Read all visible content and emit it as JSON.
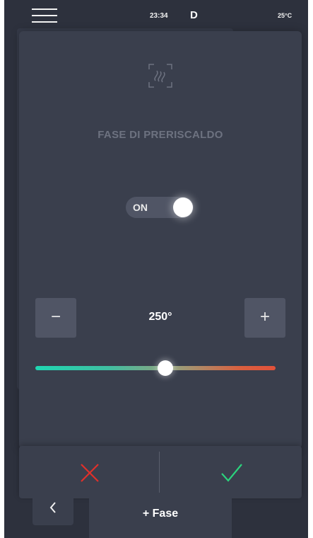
{
  "status_bar": {
    "time": "23:34",
    "mode": "D",
    "temperature": "25°C"
  },
  "phase": {
    "icon": "heat-waves-icon",
    "title": "FASE DI PRERISCALDO"
  },
  "toggle": {
    "label": "ON",
    "state": true
  },
  "temperature_control": {
    "value": "250°",
    "decrement_label": "−",
    "increment_label": "+",
    "slider_fraction": 0.54
  },
  "actions": {
    "cancel_icon": "close-icon",
    "confirm_icon": "check-icon"
  },
  "bottom_nav": {
    "back_icon": "chevron-left-icon",
    "add_phase_label": "+ Fase"
  },
  "colors": {
    "background": "#2d313d",
    "card": "#3a3f4d",
    "cancel": "#e0302a",
    "confirm": "#2bd37d",
    "slider_start": "#1fd6b2",
    "slider_end": "#e2513a"
  }
}
